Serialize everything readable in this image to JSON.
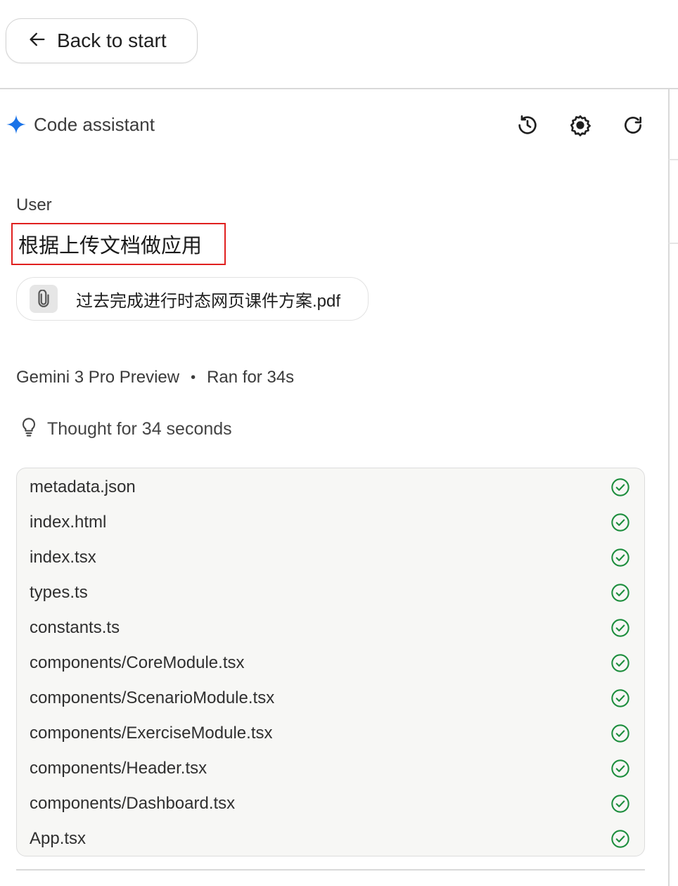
{
  "back_button": {
    "label": "Back to start"
  },
  "assistant": {
    "title": "Code assistant"
  },
  "header_icons": [
    "history-icon",
    "settings-icon",
    "refresh-icon"
  ],
  "conversation": {
    "user_label": "User",
    "user_message": "根据上传文档做应用",
    "attachment": {
      "name": "过去完成进行时态网页课件方案.pdf",
      "icon": "paperclip-icon"
    },
    "model": "Gemini 3 Pro Preview",
    "separator": "•",
    "run_time": "Ran for 34s",
    "thought": "Thought for 34 seconds"
  },
  "files": [
    {
      "name": "metadata.json",
      "status": "done"
    },
    {
      "name": "index.html",
      "status": "done"
    },
    {
      "name": "index.tsx",
      "status": "done"
    },
    {
      "name": "types.ts",
      "status": "done"
    },
    {
      "name": "constants.ts",
      "status": "done"
    },
    {
      "name": "components/CoreModule.tsx",
      "status": "done"
    },
    {
      "name": "components/ScenarioModule.tsx",
      "status": "done"
    },
    {
      "name": "components/ExerciseModule.tsx",
      "status": "done"
    },
    {
      "name": "components/Header.tsx",
      "status": "done"
    },
    {
      "name": "components/Dashboard.tsx",
      "status": "done"
    },
    {
      "name": "App.tsx",
      "status": "done"
    }
  ],
  "colors": {
    "accent_blue": "#1a73e8",
    "success_green": "#1e8e3e",
    "highlight_red": "#e0201f"
  }
}
